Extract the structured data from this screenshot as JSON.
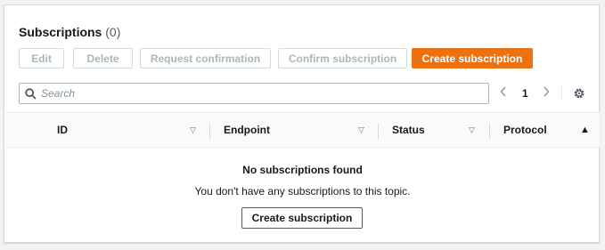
{
  "header": {
    "title": "Subscriptions",
    "count": "(0)"
  },
  "toolbar": {
    "edit": "Edit",
    "delete": "Delete",
    "request_confirmation": "Request confirmation",
    "confirm_subscription": "Confirm subscription",
    "create_subscription": "Create subscription"
  },
  "search": {
    "placeholder": "Search",
    "value": ""
  },
  "pagination": {
    "page": "1",
    "prev_icon": "chevron-left-icon",
    "next_icon": "chevron-right-icon"
  },
  "settings_icon": "gear-icon",
  "table": {
    "columns": [
      {
        "label": "ID",
        "sort": "▽"
      },
      {
        "label": "Endpoint",
        "sort": "▽"
      },
      {
        "label": "Status",
        "sort": "▽"
      },
      {
        "label": "Protocol",
        "sort": "▲"
      }
    ],
    "empty": {
      "title": "No subscriptions found",
      "description": "You don't have any subscriptions to this topic.",
      "button": "Create subscription"
    }
  },
  "colors": {
    "accent": "#ec7211",
    "disabled_text": "#aab7b8",
    "border": "#d5dbdb"
  }
}
